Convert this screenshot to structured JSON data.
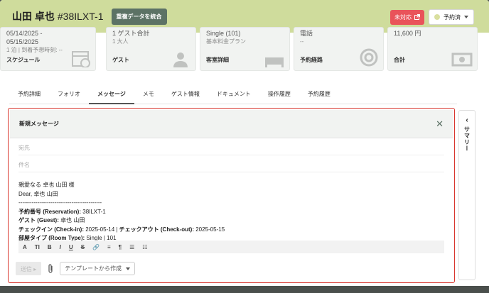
{
  "header": {
    "guest_name": "山田 卓也",
    "reservation_id": "#38ILXT-1",
    "merge_button": "重複データを統合",
    "status_button": "未対応",
    "state_select": "予約済"
  },
  "cards": [
    {
      "top": "05/14/2025 -",
      "top2": "05/15/2025",
      "sub": "1 泊 | 到着予想時刻: --",
      "label": "スケジュール"
    },
    {
      "top": "1 ゲスト合計",
      "sub": "1 大人",
      "label": "ゲスト"
    },
    {
      "top": "Single (101)",
      "sub": "基本料金プラン",
      "label": "客室詳細"
    },
    {
      "top": "電話",
      "sub": "--",
      "label": "予約経路"
    },
    {
      "top": "11,600 円",
      "sub": "",
      "label": "合計"
    }
  ],
  "tabs": [
    "予約詳細",
    "フォリオ",
    "メッセージ",
    "メモ",
    "ゲスト情報",
    "ドキュメント",
    "操作履歴",
    "予約履歴"
  ],
  "active_tab": "メッセージ",
  "message": {
    "title": "新規メッセージ",
    "to_placeholder": "宛先",
    "subject_placeholder": "件名",
    "greeting1": "親愛なる 卓也 山田 様",
    "greeting2": "Dear, 卓也 山田",
    "divider": "--------------------------------------------",
    "lines": [
      {
        "label": "予約番号 (Reservation):",
        "value": " 38ILXT-1"
      },
      {
        "label": "ゲスト (Guest):",
        "value": " 卓也 山田"
      },
      {
        "label": "チェックイン (Check-in):",
        "value": " 2025-05-14 | ",
        "label2": "チェックアウト (Check-out):",
        "value2": " 2025-05-15"
      },
      {
        "label": "部屋タイプ (Room Type):",
        "value": " Single | 101"
      }
    ],
    "send_label": "送信",
    "template_label": "テンプレートから作成"
  },
  "toolbar": {
    "font": "A",
    "size": "TI",
    "bold": "B",
    "italic": "I",
    "underline": "U",
    "strike": "S",
    "link": "🔗",
    "align": "≡",
    "para": "¶",
    "ul": "☰",
    "ol": "☷"
  },
  "summary": {
    "label": "サマリー"
  }
}
